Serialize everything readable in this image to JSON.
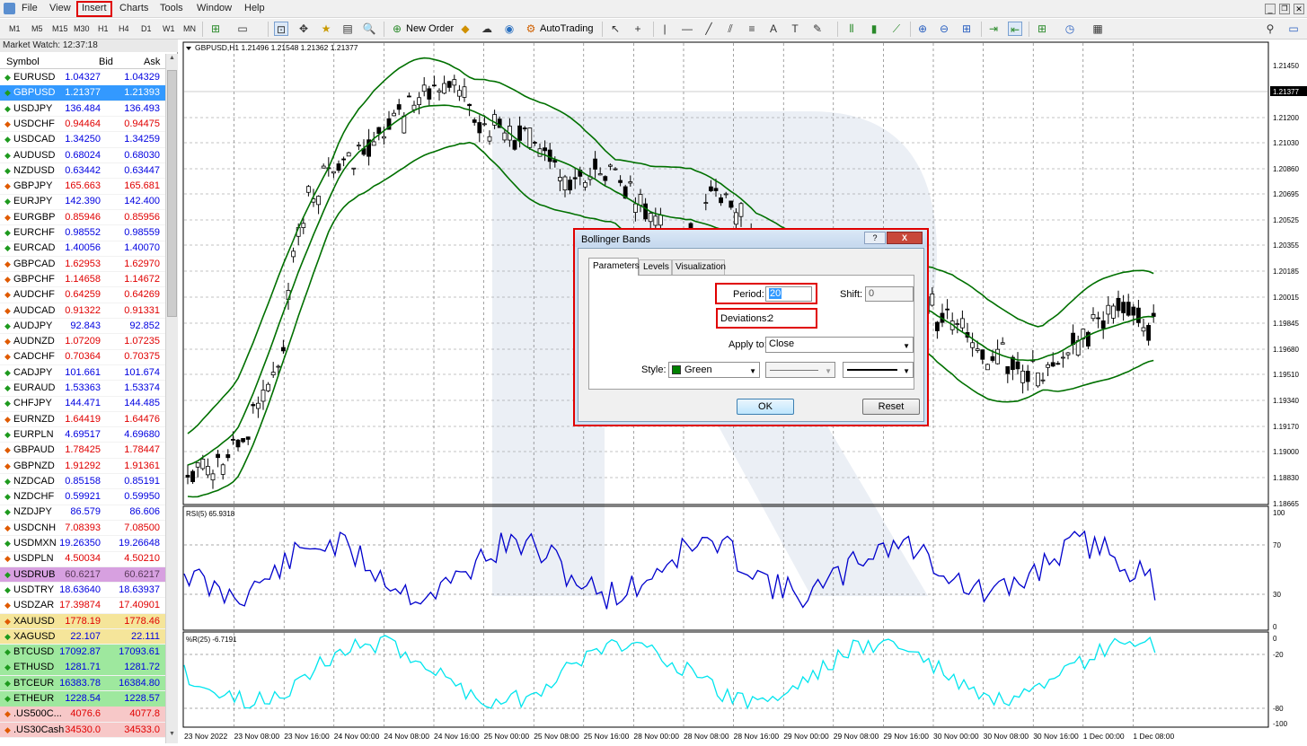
{
  "menu": [
    "File",
    "View",
    "Insert",
    "Charts",
    "Tools",
    "Window",
    "Help"
  ],
  "menu_highlight": "Insert",
  "timeframes": [
    "M1",
    "M5",
    "M15",
    "M30",
    "H1",
    "H4",
    "D1",
    "W1",
    "MN"
  ],
  "toolbar": {
    "new_order": "New Order",
    "autotrading": "AutoTrading"
  },
  "market_watch": {
    "title": "Market Watch: 12:37:18",
    "columns": [
      "Symbol",
      "Bid",
      "Ask"
    ],
    "rows": [
      {
        "symbol": "EURUSD",
        "bid": "1.04327",
        "ask": "1.04329",
        "dir": "up",
        "color": "#0000e0",
        "bg": ""
      },
      {
        "symbol": "GBPUSD",
        "bid": "1.21377",
        "ask": "1.21393",
        "dir": "up",
        "color": "#ffffff",
        "bg": "#3399ff"
      },
      {
        "symbol": "USDJPY",
        "bid": "136.484",
        "ask": "136.493",
        "dir": "up",
        "color": "#0000e0",
        "bg": ""
      },
      {
        "symbol": "USDCHF",
        "bid": "0.94464",
        "ask": "0.94475",
        "dir": "down",
        "color": "#e00000",
        "bg": ""
      },
      {
        "symbol": "USDCAD",
        "bid": "1.34250",
        "ask": "1.34259",
        "dir": "up",
        "color": "#0000e0",
        "bg": ""
      },
      {
        "symbol": "AUDUSD",
        "bid": "0.68024",
        "ask": "0.68030",
        "dir": "up",
        "color": "#0000e0",
        "bg": ""
      },
      {
        "symbol": "NZDUSD",
        "bid": "0.63442",
        "ask": "0.63447",
        "dir": "up",
        "color": "#0000e0",
        "bg": ""
      },
      {
        "symbol": "GBPJPY",
        "bid": "165.663",
        "ask": "165.681",
        "dir": "down",
        "color": "#e00000",
        "bg": ""
      },
      {
        "symbol": "EURJPY",
        "bid": "142.390",
        "ask": "142.400",
        "dir": "up",
        "color": "#0000e0",
        "bg": ""
      },
      {
        "symbol": "EURGBP",
        "bid": "0.85946",
        "ask": "0.85956",
        "dir": "down",
        "color": "#e00000",
        "bg": ""
      },
      {
        "symbol": "EURCHF",
        "bid": "0.98552",
        "ask": "0.98559",
        "dir": "up",
        "color": "#0000e0",
        "bg": ""
      },
      {
        "symbol": "EURCAD",
        "bid": "1.40056",
        "ask": "1.40070",
        "dir": "up",
        "color": "#0000e0",
        "bg": ""
      },
      {
        "symbol": "GBPCAD",
        "bid": "1.62953",
        "ask": "1.62970",
        "dir": "down",
        "color": "#e00000",
        "bg": ""
      },
      {
        "symbol": "GBPCHF",
        "bid": "1.14658",
        "ask": "1.14672",
        "dir": "down",
        "color": "#e00000",
        "bg": ""
      },
      {
        "symbol": "AUDCHF",
        "bid": "0.64259",
        "ask": "0.64269",
        "dir": "down",
        "color": "#e00000",
        "bg": ""
      },
      {
        "symbol": "AUDCAD",
        "bid": "0.91322",
        "ask": "0.91331",
        "dir": "down",
        "color": "#e00000",
        "bg": ""
      },
      {
        "symbol": "AUDJPY",
        "bid": "92.843",
        "ask": "92.852",
        "dir": "up",
        "color": "#0000e0",
        "bg": ""
      },
      {
        "symbol": "AUDNZD",
        "bid": "1.07209",
        "ask": "1.07235",
        "dir": "down",
        "color": "#e00000",
        "bg": ""
      },
      {
        "symbol": "CADCHF",
        "bid": "0.70364",
        "ask": "0.70375",
        "dir": "down",
        "color": "#e00000",
        "bg": ""
      },
      {
        "symbol": "CADJPY",
        "bid": "101.661",
        "ask": "101.674",
        "dir": "up",
        "color": "#0000e0",
        "bg": ""
      },
      {
        "symbol": "EURAUD",
        "bid": "1.53363",
        "ask": "1.53374",
        "dir": "up",
        "color": "#0000e0",
        "bg": ""
      },
      {
        "symbol": "CHFJPY",
        "bid": "144.471",
        "ask": "144.485",
        "dir": "up",
        "color": "#0000e0",
        "bg": ""
      },
      {
        "symbol": "EURNZD",
        "bid": "1.64419",
        "ask": "1.64476",
        "dir": "down",
        "color": "#e00000",
        "bg": ""
      },
      {
        "symbol": "EURPLN",
        "bid": "4.69517",
        "ask": "4.69680",
        "dir": "up",
        "color": "#0000e0",
        "bg": ""
      },
      {
        "symbol": "GBPAUD",
        "bid": "1.78425",
        "ask": "1.78447",
        "dir": "down",
        "color": "#e00000",
        "bg": ""
      },
      {
        "symbol": "GBPNZD",
        "bid": "1.91292",
        "ask": "1.91361",
        "dir": "down",
        "color": "#e00000",
        "bg": ""
      },
      {
        "symbol": "NZDCAD",
        "bid": "0.85158",
        "ask": "0.85191",
        "dir": "up",
        "color": "#0000e0",
        "bg": ""
      },
      {
        "symbol": "NZDCHF",
        "bid": "0.59921",
        "ask": "0.59950",
        "dir": "up",
        "color": "#0000e0",
        "bg": ""
      },
      {
        "symbol": "NZDJPY",
        "bid": "86.579",
        "ask": "86.606",
        "dir": "up",
        "color": "#0000e0",
        "bg": ""
      },
      {
        "symbol": "USDCNH",
        "bid": "7.08393",
        "ask": "7.08500",
        "dir": "down",
        "color": "#e00000",
        "bg": ""
      },
      {
        "symbol": "USDMXN",
        "bid": "19.26350",
        "ask": "19.26648",
        "dir": "up",
        "color": "#0000e0",
        "bg": ""
      },
      {
        "symbol": "USDPLN",
        "bid": "4.50034",
        "ask": "4.50210",
        "dir": "down",
        "color": "#e00000",
        "bg": ""
      },
      {
        "symbol": "USDRUB",
        "bid": "60.6217",
        "ask": "60.6217",
        "dir": "up",
        "color": "#5a3a5a",
        "bg": "#d7a0e0"
      },
      {
        "symbol": "USDTRY",
        "bid": "18.63640",
        "ask": "18.63937",
        "dir": "up",
        "color": "#0000e0",
        "bg": ""
      },
      {
        "symbol": "USDZAR",
        "bid": "17.39874",
        "ask": "17.40901",
        "dir": "down",
        "color": "#e00000",
        "bg": ""
      },
      {
        "symbol": "XAUUSD",
        "bid": "1778.19",
        "ask": "1778.46",
        "dir": "down",
        "color": "#e00000",
        "bg": "#f5e59a"
      },
      {
        "symbol": "XAGUSD",
        "bid": "22.107",
        "ask": "22.111",
        "dir": "up",
        "color": "#0000e0",
        "bg": "#f5e59a"
      },
      {
        "symbol": "BTCUSD",
        "bid": "17092.87",
        "ask": "17093.61",
        "dir": "up",
        "color": "#0000e0",
        "bg": "#9ee89e"
      },
      {
        "symbol": "ETHUSD",
        "bid": "1281.71",
        "ask": "1281.72",
        "dir": "up",
        "color": "#0000e0",
        "bg": "#9ee89e"
      },
      {
        "symbol": "BTCEUR",
        "bid": "16383.78",
        "ask": "16384.80",
        "dir": "up",
        "color": "#0000e0",
        "bg": "#9ee89e"
      },
      {
        "symbol": "ETHEUR",
        "bid": "1228.54",
        "ask": "1228.57",
        "dir": "up",
        "color": "#0000e0",
        "bg": "#9ee89e"
      },
      {
        "symbol": ".US500C...",
        "bid": "4076.6",
        "ask": "4077.8",
        "dir": "down",
        "color": "#e00000",
        "bg": "#f7c8c8"
      },
      {
        "symbol": ".US30Cash",
        "bid": "34530.0",
        "ask": "34533.0",
        "dir": "down",
        "color": "#e00000",
        "bg": "#f7c8c8"
      }
    ]
  },
  "chart": {
    "header": "GBPUSD,H1  1.21496 1.21548 1.21362 1.21377",
    "current_price": "1.21377",
    "price_ticks": [
      "1.21450",
      "1.21377",
      "1.21200",
      "1.21030",
      "1.20860",
      "1.20695",
      "1.20525",
      "1.20355",
      "1.20185",
      "1.20015",
      "1.19845",
      "1.19680",
      "1.19510",
      "1.19340",
      "1.19170",
      "1.19000",
      "1.18830",
      "1.18665"
    ],
    "rsi_label": "RSI(5) 65.9318",
    "rsi_ticks": [
      "100",
      "70",
      "30",
      "0"
    ],
    "wpr_label": "%R(25) -6.7191",
    "wpr_ticks": [
      "0",
      "-20",
      "-80",
      "-100"
    ],
    "time_ticks": [
      "23 Nov 2022",
      "23 Nov 08:00",
      "23 Nov 16:00",
      "24 Nov 00:00",
      "24 Nov 08:00",
      "24 Nov 16:00",
      "25 Nov 00:00",
      "25 Nov 08:00",
      "25 Nov 16:00",
      "28 Nov 00:00",
      "28 Nov 08:00",
      "28 Nov 16:00",
      "29 Nov 00:00",
      "29 Nov 08:00",
      "29 Nov 16:00",
      "30 Nov 00:00",
      "30 Nov 08:00",
      "30 Nov 16:00",
      "1 Dec 00:00",
      "1 Dec 08:00"
    ],
    "band_color": "#007000",
    "rsi_color": "#0000cc",
    "wpr_color": "#00e5ee"
  },
  "dialog": {
    "title": "Bollinger Bands",
    "title_buttons": [
      "?",
      "X"
    ],
    "tabs": [
      "Parameters",
      "Levels",
      "Visualization"
    ],
    "period_label": "Period:",
    "period_value": "20",
    "shift_label": "Shift:",
    "shift_value": "0",
    "deviations_label": "Deviations:",
    "deviations_value": "2",
    "apply_label": "Apply to:",
    "apply_value": "Close",
    "style_label": "Style:",
    "style_color_name": "Green",
    "style_color": "#008000",
    "ok": "OK",
    "reset": "Reset"
  }
}
